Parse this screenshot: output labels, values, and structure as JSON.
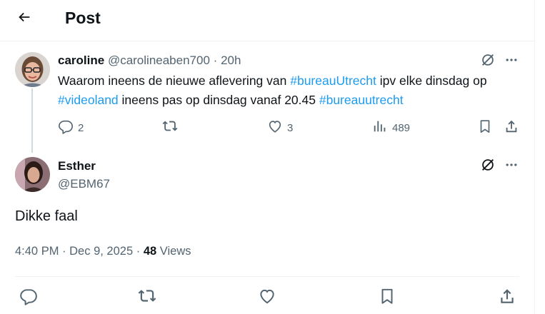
{
  "header": {
    "title": "Post"
  },
  "parent_post": {
    "display_name": "caroline",
    "handle": "@carolineaben700",
    "separator": "·",
    "age": "20h",
    "text": {
      "t1": "Waarom ineens de nieuwe aflevering van ",
      "tag1": "#bureauUtrecht",
      "t2": " ipv elke dinsdag op ",
      "tag2": "#videoland",
      "t3": " ineens pas op dinsdag vanaf 20.45 ",
      "tag3": "#bureauutrecht"
    },
    "replies": "2",
    "likes": "3",
    "views": "489"
  },
  "main_post": {
    "display_name": "Esther",
    "handle": "@EBM67",
    "text": "Dikke faal",
    "time": "4:40 PM",
    "separator": "·",
    "date": "Dec 9, 2025",
    "separator2": "·",
    "views_count": "48",
    "views_label": "Views"
  },
  "icons": {
    "back": "arrow-left-icon",
    "grok": "grok-icon",
    "more": "more-dots-icon",
    "reply": "reply-icon",
    "repost": "repost-icon",
    "like": "like-icon",
    "views": "views-icon",
    "bookmark": "bookmark-icon",
    "share": "share-icon"
  },
  "colors": {
    "link": "#1d9bf0",
    "muted": "#536471",
    "text": "#0f1419"
  }
}
